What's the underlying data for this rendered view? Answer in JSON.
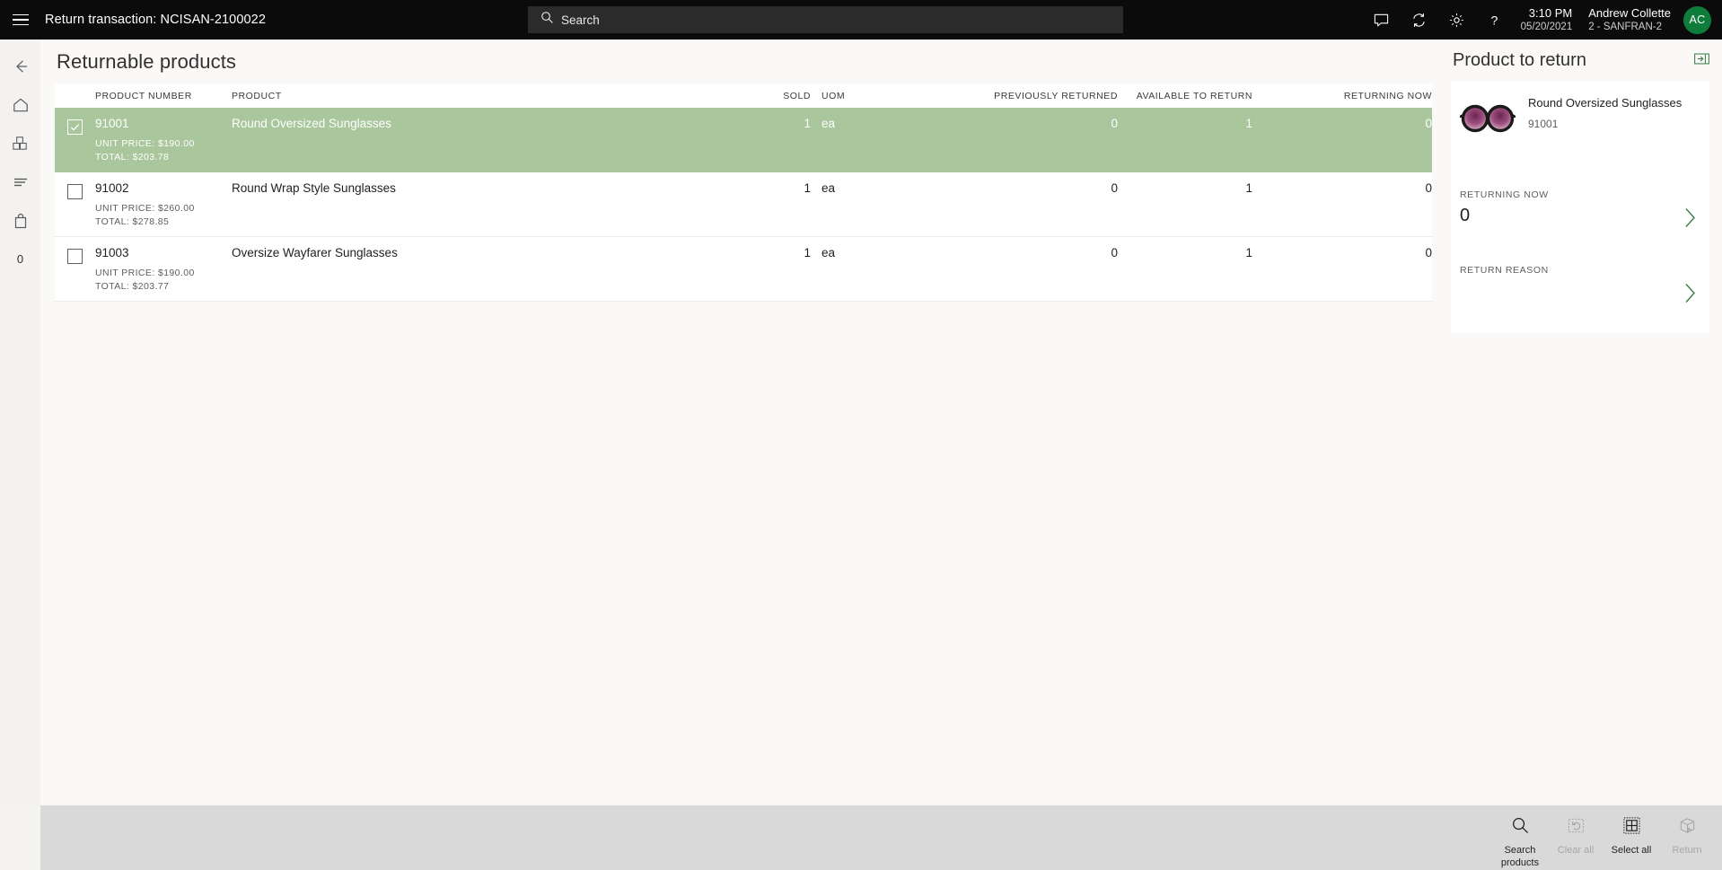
{
  "header": {
    "menu_icon": "hamburger-icon",
    "title": "Return transaction: NCISAN-2100022",
    "search": {
      "icon": "search-icon",
      "placeholder": "Search",
      "value": ""
    },
    "icons": [
      {
        "name": "feedback-icon"
      },
      {
        "name": "sync-icon"
      },
      {
        "name": "settings-gear-icon"
      },
      {
        "name": "help-icon"
      }
    ],
    "time": "3:10 PM",
    "date": "05/20/2021",
    "user_name": "Andrew Collette",
    "user_store": "2 - SANFRAN-2",
    "avatar_initials": "AC",
    "avatar_color": "#0e7c3a"
  },
  "rail": {
    "items": [
      {
        "name": "back-arrow-icon",
        "label": ""
      },
      {
        "name": "home-icon",
        "label": ""
      },
      {
        "name": "products-icon",
        "label": ""
      },
      {
        "name": "journal-lines-icon",
        "label": ""
      },
      {
        "name": "shopping-bag-icon",
        "label": ""
      },
      {
        "name": "cart-count",
        "label": "0"
      }
    ]
  },
  "main": {
    "page_title": "Returnable products",
    "columns": [
      "PRODUCT NUMBER",
      "PRODUCT",
      "SOLD",
      "UOM",
      "PREVIOUSLY RETURNED",
      "AVAILABLE TO RETURN",
      "RETURNING NOW"
    ],
    "rows": [
      {
        "selected": true,
        "checked": true,
        "product_number": "91001",
        "product": "Round Oversized Sunglasses",
        "unit_price": "UNIT PRICE: $190.00",
        "total": "TOTAL: $203.78",
        "sold": "1",
        "uom": "ea",
        "previously_returned": "0",
        "available_to_return": "1",
        "returning_now": "0"
      },
      {
        "selected": false,
        "checked": false,
        "product_number": "91002",
        "product": "Round Wrap Style Sunglasses",
        "unit_price": "UNIT PRICE: $260.00",
        "total": "TOTAL: $278.85",
        "sold": "1",
        "uom": "ea",
        "previously_returned": "0",
        "available_to_return": "1",
        "returning_now": "0"
      },
      {
        "selected": false,
        "checked": false,
        "product_number": "91003",
        "product": "Oversize Wayfarer Sunglasses",
        "unit_price": "UNIT PRICE: $190.00",
        "total": "TOTAL: $203.77",
        "sold": "1",
        "uom": "ea",
        "previously_returned": "0",
        "available_to_return": "1",
        "returning_now": "0"
      }
    ],
    "selected_row_color": "#a9c69c"
  },
  "right_panel": {
    "title": "Product to return",
    "expand_icon": "expand-panel-icon",
    "product": {
      "image": "sunglasses-thumbnail",
      "name": "Round Oversized Sunglasses",
      "number": "91001"
    },
    "fields": [
      {
        "label": "RETURNING NOW",
        "value": "0",
        "chevron": "chevron-right-icon"
      },
      {
        "label": "RETURN REASON",
        "value": "",
        "chevron": "chevron-right-icon"
      }
    ]
  },
  "bottom_toolbar": {
    "buttons": [
      {
        "label": "Search products",
        "icon": "search-icon",
        "enabled": true
      },
      {
        "label": "Clear all",
        "icon": "clear-all-icon",
        "enabled": false
      },
      {
        "label": "Select all",
        "icon": "select-all-icon",
        "enabled": true
      },
      {
        "label": "Return",
        "icon": "return-box-icon",
        "enabled": false
      }
    ]
  }
}
